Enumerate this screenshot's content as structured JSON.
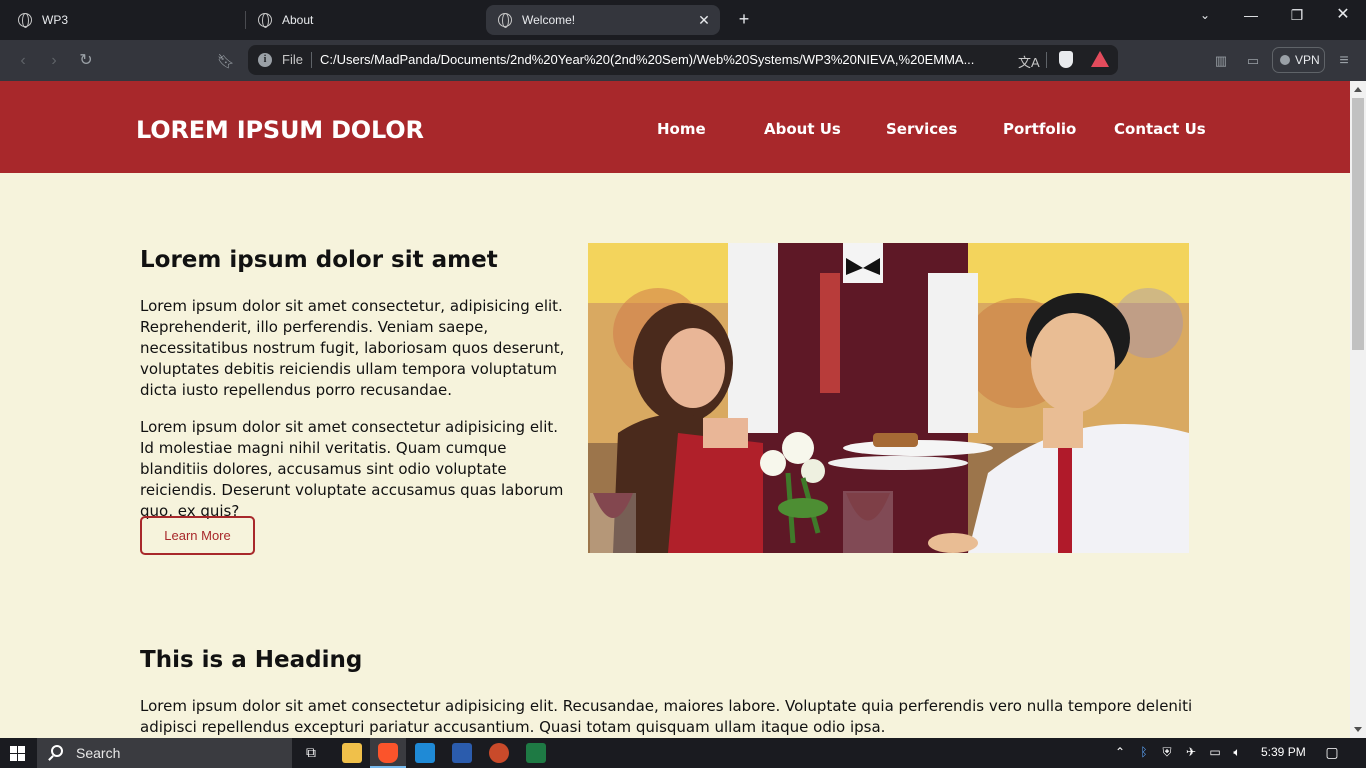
{
  "browser": {
    "tabs": [
      {
        "title": "WP3",
        "active": false
      },
      {
        "title": "About",
        "active": false
      },
      {
        "title": "Welcome!",
        "active": true
      }
    ],
    "omnibox": {
      "scheme_label": "File",
      "url": "C:/Users/MadPanda/Documents/2nd%20Year%20(2nd%20Sem)/Web%20Systems/WP3%20NIEVA,%20EMMA..."
    },
    "vpn_label": "VPN"
  },
  "site": {
    "brand": "LOREM IPSUM DOLOR",
    "nav": [
      "Home",
      "About Us",
      "Services",
      "Portfolio",
      "Contact Us"
    ],
    "colors": {
      "header": "#a8282b",
      "background": "#f6f3dc"
    }
  },
  "section1": {
    "title": "Lorem ipsum dolor sit amet",
    "paragraph1": "Lorem ipsum dolor sit amet consectetur, adipisicing elit. Reprehenderit, illo perferendis. Veniam saepe, necessitatibus nostrum fugit, laboriosam quos deserunt, voluptates debitis reiciendis ullam tempora voluptatum dicta iusto repellendus porro recusandae.",
    "paragraph2": "Lorem ipsum dolor sit amet consectetur adipisicing elit. Id molestiae magni nihil veritatis. Quam cumque blanditiis dolores, accusamus sint odio voluptate reiciendis. Deserunt voluptate accusamus quas laborum quo, ex quis?",
    "button": "Learn More"
  },
  "section2": {
    "title": "This is a Heading",
    "paragraph": "Lorem ipsum dolor sit amet consectetur adipisicing elit. Recusandae, maiores labore. Voluptate quia perferendis vero nulla tempore deleniti adipisci repellendus excepturi pariatur accusantium. Quasi totam quisquam ullam itaque odio ipsa."
  },
  "taskbar": {
    "search_label": "Search",
    "time": "5:39 PM"
  }
}
